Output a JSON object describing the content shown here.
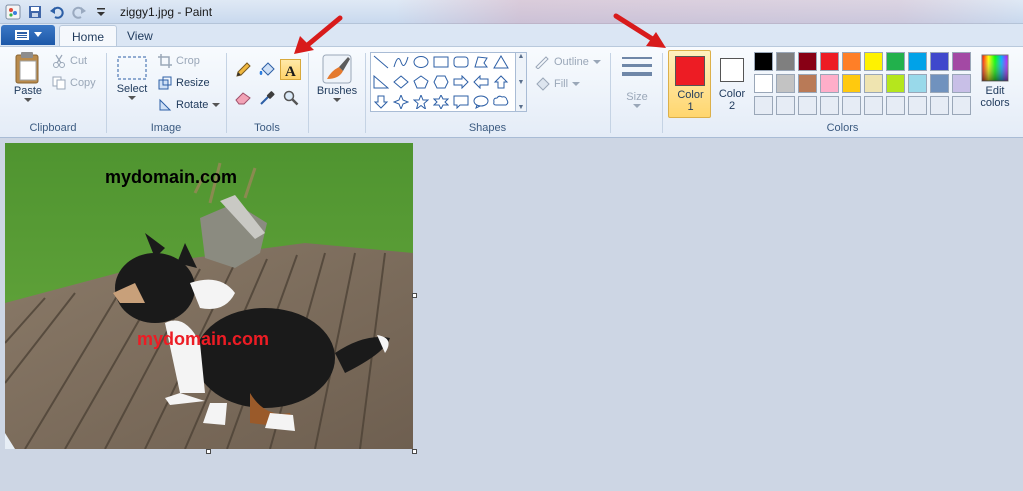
{
  "titlebar": {
    "title": "ziggy1.jpg - Paint"
  },
  "tabs": {
    "home": "Home",
    "view": "View"
  },
  "clipboard": {
    "paste": "Paste",
    "cut": "Cut",
    "copy": "Copy",
    "group": "Clipboard"
  },
  "image": {
    "select": "Select",
    "crop": "Crop",
    "resize": "Resize",
    "rotate": "Rotate",
    "group": "Image"
  },
  "tools": {
    "group": "Tools",
    "brushes": "Brushes"
  },
  "shapes": {
    "outline": "Outline",
    "fill": "Fill",
    "group": "Shapes",
    "size": "Size"
  },
  "colors": {
    "color1_line1": "Color",
    "color1_line2": "1",
    "color2_line1": "Color",
    "color2_line2": "2",
    "edit_line1": "Edit",
    "edit_line2": "colors",
    "group": "Colors",
    "color1_value": "#ed1c24",
    "color2_value": "#ffffff",
    "palette_row1": [
      "#000000",
      "#7f7f7f",
      "#880015",
      "#ed1c24",
      "#ff7f27",
      "#fff200",
      "#22b14c",
      "#00a2e8",
      "#3f48cc",
      "#a349a4"
    ],
    "palette_row2": [
      "#ffffff",
      "#c3c3c3",
      "#b97a57",
      "#ffaec9",
      "#ffc90e",
      "#efe4b0",
      "#b5e61d",
      "#99d9ea",
      "#7092be",
      "#c8bfe7"
    ],
    "palette_row3": [
      "#e6ecf5",
      "#e6ecf5",
      "#e6ecf5",
      "#e6ecf5",
      "#e6ecf5",
      "#e6ecf5",
      "#e6ecf5",
      "#e6ecf5",
      "#e6ecf5",
      "#e6ecf5"
    ]
  },
  "canvas": {
    "watermark_top": "mydomain.com",
    "watermark_mid": "mydomain.com"
  }
}
